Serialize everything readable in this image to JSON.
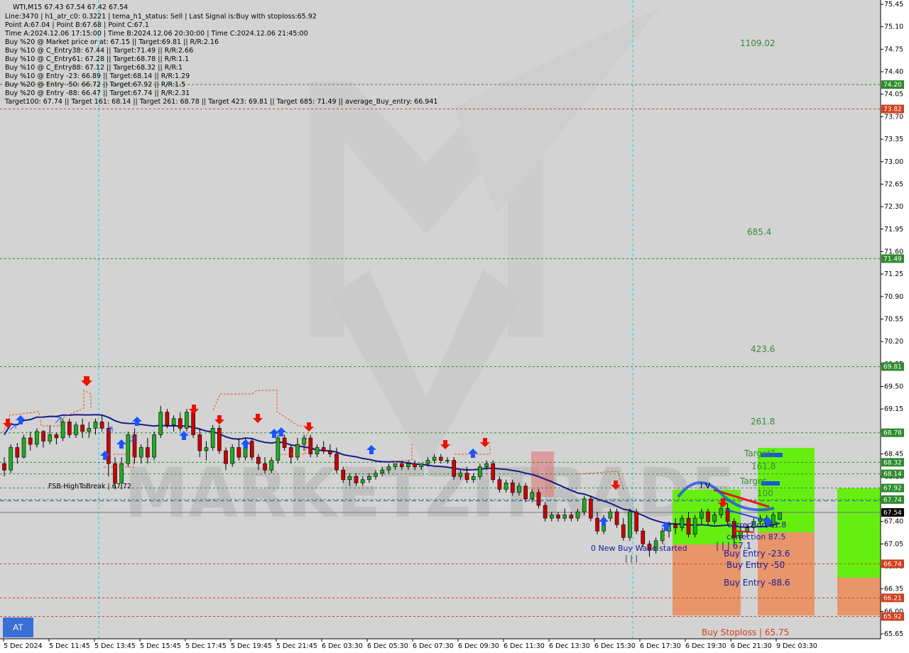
{
  "info_lines": [
    "WTI,M15  67.43 67.54 67.42 67.54",
    "Line:3470  |  h1_atr_c0: 0.3221  |  tema_h1_status: Sell  |  Last Signal is:Buy with stoploss:65.92",
    "Point A:67.04  |  Point B:67.68  |  Point C:67.1",
    "Time A:2024.12.06 17:15:00  |  Time B:2024.12.06 20:30:00  |  Time C:2024.12.06 21:45:00",
    "Buy %20 @ Market price or at: 67.15  ||  Target:69.81  ||  R/R:2.16",
    "Buy %10 @ C_Entry38: 67.44  ||  Target:71.49  ||  R/R:2.66",
    "Buy %10 @ C_Entry61: 67.28  ||  Target:68.78  ||  R/R:1.1",
    "Buy %10 @ C_Entry88: 67.12  ||  Target:68.32  ||  R/R:1",
    "Buy %10 @ Entry -23: 66.89  ||  Target:68.14  ||  R/R:1.29",
    "Buy %20 @ Entry -50: 66.72  ||  Target:67.92  ||  R/R:1.5",
    "Buy %20 @ Entry -88: 66.47  ||  Target:67.74  ||  R/R:2.31",
    "Target100: 67.74  ||  Target 161: 68.14  ||  Target 261: 68.78  ||  Target 423: 69.81  ||  Target 685: 71.49  ||  average_Buy_entry: 66.941"
  ],
  "colors": {
    "background": "#d3d3d3",
    "bull_candle": "#22aa22",
    "bear_candle": "#cc0000",
    "ma_line": "#1a1a8c",
    "target_line": "#2e8b2e",
    "stop_line": "#d04020",
    "green_zone": "#66ee11",
    "orange_zone": "#e8956a",
    "buy_arrow": "#1a55ff",
    "sell_arrow": "#ee1100"
  },
  "price_axis": {
    "min": 65.65,
    "max": 75.45,
    "ticks": [
      "75.45",
      "75.10",
      "74.75",
      "74.40",
      "74.05",
      "73.70",
      "73.35",
      "73.00",
      "72.65",
      "72.30",
      "71.95",
      "71.60",
      "71.25",
      "70.90",
      "70.55",
      "70.20",
      "69.85",
      "69.50",
      "69.15",
      "68.80",
      "68.45",
      "68.10",
      "67.75",
      "67.40",
      "67.05",
      "66.70",
      "66.35",
      "66.00",
      "65.65"
    ]
  },
  "level_tags": [
    {
      "label": "74.20",
      "price": 74.2,
      "color": "#2e8b2e"
    },
    {
      "label": "73.82",
      "price": 73.82,
      "color": "#d04020"
    },
    {
      "label": "71.49",
      "price": 71.49,
      "color": "#2e8b2e"
    },
    {
      "label": "69.81",
      "price": 69.81,
      "color": "#2e8b2e"
    },
    {
      "label": "68.78",
      "price": 68.78,
      "color": "#2e8b2e"
    },
    {
      "label": "68.32",
      "price": 68.32,
      "color": "#2e8b2e"
    },
    {
      "label": "68.14",
      "price": 68.14,
      "color": "#2e8b2e"
    },
    {
      "label": "67.92",
      "price": 67.92,
      "color": "#2e8b2e"
    },
    {
      "label": "67.74",
      "price": 67.74,
      "color": "#2e8b2e"
    },
    {
      "label": "67.54",
      "price": 67.54,
      "color": "#000000"
    },
    {
      "label": "66.74",
      "price": 66.74,
      "color": "#d04020"
    },
    {
      "label": "66.21",
      "price": 66.21,
      "color": "#d04020"
    },
    {
      "label": "65.92",
      "price": 65.92,
      "color": "#d04020"
    }
  ],
  "date_labels": [
    "5 Dec 2024",
    "5 Dec 11:45",
    "5 Dec 13:45",
    "5 Dec 15:45",
    "5 Dec 17:45",
    "5 Dec 19:45",
    "5 Dec 21:45",
    "6 Dec 03:30",
    "6 Dec 05:30",
    "6 Dec 07:30",
    "6 Dec 09:30",
    "6 Dec 11:30",
    "6 Dec 13:30",
    "6 Dec 15:30",
    "6 Dec 17:30",
    "6 Dec 19:30",
    "6 Dec 21:30",
    "9 Dec 03:30"
  ],
  "chart_labels": {
    "t1109": "1109.02",
    "t685": "685.4",
    "t423": "423.6",
    "t261": "261.8",
    "t161": "161.8",
    "t100": "100",
    "target_a": "Target1",
    "target_b": "Target",
    "corr1": "correction 61.8",
    "corr2": "correction 87.5",
    "point_c": "| | | 67.1",
    "roman": "I V",
    "buy_wave": "0 New Buy Wave started",
    "entry23": "Buy Entry -23.6",
    "entry50": "Buy Entry -50",
    "entry88": "Buy Entry -88.6",
    "stoploss": "Buy Stoploss | 65.75",
    "fsb": "FSB-HighToBreak | 67.72",
    "watermark": "MARKETZITRADE"
  },
  "at_button": "AT",
  "chart_data": {
    "type": "candlestick",
    "title": "WTI,M15",
    "timeframe": "M15",
    "ylim": [
      65.65,
      75.45
    ],
    "last_price": 67.54,
    "candles": [
      [
        68.3,
        68.4,
        68.1,
        68.2
      ],
      [
        68.2,
        68.6,
        68.15,
        68.55
      ],
      [
        68.55,
        68.62,
        68.3,
        68.4
      ],
      [
        68.4,
        68.75,
        68.38,
        68.7
      ],
      [
        68.7,
        68.8,
        68.5,
        68.6
      ],
      [
        68.6,
        68.85,
        68.55,
        68.8
      ],
      [
        68.8,
        68.82,
        68.55,
        68.65
      ],
      [
        68.65,
        68.9,
        68.6,
        68.75
      ],
      [
        68.75,
        68.78,
        68.6,
        68.7
      ],
      [
        68.7,
        69.0,
        68.65,
        68.95
      ],
      [
        68.95,
        69.0,
        68.7,
        68.75
      ],
      [
        68.75,
        68.95,
        68.7,
        68.9
      ],
      [
        68.9,
        69.0,
        68.7,
        68.8
      ],
      [
        68.8,
        68.95,
        68.7,
        68.85
      ],
      [
        68.85,
        69.0,
        68.75,
        68.95
      ],
      [
        68.95,
        69.05,
        68.8,
        68.85
      ],
      [
        68.85,
        68.95,
        68.1,
        68.3
      ],
      [
        68.3,
        68.4,
        67.9,
        68.0
      ],
      [
        68.0,
        68.4,
        67.9,
        68.3
      ],
      [
        68.3,
        68.8,
        68.25,
        68.75
      ],
      [
        68.75,
        68.85,
        68.3,
        68.4
      ],
      [
        68.4,
        68.6,
        68.3,
        68.55
      ],
      [
        68.55,
        68.7,
        68.3,
        68.4
      ],
      [
        68.4,
        68.8,
        68.35,
        68.75
      ],
      [
        68.75,
        69.2,
        68.7,
        69.1
      ],
      [
        69.1,
        69.15,
        68.85,
        68.9
      ],
      [
        68.9,
        69.05,
        68.8,
        69.0
      ],
      [
        69.0,
        69.1,
        68.8,
        68.85
      ],
      [
        68.85,
        69.15,
        68.8,
        69.1
      ],
      [
        69.1,
        69.15,
        68.7,
        68.75
      ],
      [
        68.75,
        68.85,
        68.4,
        68.5
      ],
      [
        68.5,
        68.65,
        68.35,
        68.55
      ],
      [
        68.55,
        68.9,
        68.5,
        68.85
      ],
      [
        68.85,
        68.9,
        68.45,
        68.5
      ],
      [
        68.5,
        68.55,
        68.2,
        68.3
      ],
      [
        68.3,
        68.6,
        68.25,
        68.55
      ],
      [
        68.55,
        68.7,
        68.35,
        68.4
      ],
      [
        68.4,
        68.7,
        68.35,
        68.65
      ],
      [
        68.65,
        68.7,
        68.35,
        68.4
      ],
      [
        68.4,
        68.45,
        68.2,
        68.3
      ],
      [
        68.3,
        68.4,
        68.15,
        68.2
      ],
      [
        68.2,
        68.4,
        68.15,
        68.35
      ],
      [
        68.35,
        68.75,
        68.3,
        68.7
      ],
      [
        68.7,
        68.75,
        68.5,
        68.55
      ],
      [
        68.55,
        68.6,
        68.3,
        68.4
      ],
      [
        68.4,
        68.7,
        68.35,
        68.6
      ],
      [
        68.6,
        68.75,
        68.5,
        68.7
      ],
      [
        68.7,
        68.75,
        68.4,
        68.45
      ],
      [
        68.45,
        68.6,
        68.4,
        68.55
      ],
      [
        68.55,
        68.65,
        68.45,
        68.5
      ],
      [
        68.5,
        68.6,
        68.4,
        68.45
      ],
      [
        68.45,
        68.55,
        68.15,
        68.2
      ],
      [
        68.2,
        68.25,
        68.0,
        68.05
      ],
      [
        68.05,
        68.15,
        67.95,
        68.1
      ],
      [
        68.1,
        68.15,
        67.95,
        68.0
      ],
      [
        68.0,
        68.1,
        67.95,
        68.05
      ],
      [
        68.05,
        68.15,
        68.0,
        68.1
      ],
      [
        68.1,
        68.2,
        68.05,
        68.15
      ],
      [
        68.15,
        68.25,
        68.1,
        68.2
      ],
      [
        68.2,
        68.3,
        68.15,
        68.25
      ],
      [
        68.25,
        68.3,
        68.2,
        68.3
      ],
      [
        68.3,
        68.35,
        68.2,
        68.25
      ],
      [
        68.25,
        68.35,
        68.2,
        68.3
      ],
      [
        68.3,
        68.35,
        68.2,
        68.25
      ],
      [
        68.25,
        68.3,
        68.2,
        68.3
      ],
      [
        68.3,
        68.4,
        68.25,
        68.35
      ],
      [
        68.35,
        68.45,
        68.3,
        68.4
      ],
      [
        68.4,
        68.45,
        68.3,
        68.35
      ],
      [
        68.35,
        68.4,
        68.3,
        68.35
      ],
      [
        68.35,
        68.4,
        68.05,
        68.1
      ],
      [
        68.1,
        68.2,
        68.05,
        68.15
      ],
      [
        68.15,
        68.25,
        68.0,
        68.05
      ],
      [
        68.05,
        68.15,
        68.0,
        68.1
      ],
      [
        68.1,
        68.3,
        68.05,
        68.25
      ],
      [
        68.25,
        68.35,
        68.2,
        68.3
      ],
      [
        68.3,
        68.35,
        68.0,
        68.05
      ],
      [
        68.05,
        68.1,
        67.85,
        67.9
      ],
      [
        67.9,
        68.05,
        67.85,
        68.0
      ],
      [
        68.0,
        68.05,
        67.8,
        67.85
      ],
      [
        67.85,
        68.0,
        67.8,
        67.95
      ],
      [
        67.95,
        68.0,
        67.7,
        67.75
      ],
      [
        67.75,
        67.9,
        67.7,
        67.85
      ],
      [
        67.85,
        67.9,
        67.6,
        67.65
      ],
      [
        67.65,
        67.7,
        67.4,
        67.45
      ],
      [
        67.45,
        67.55,
        67.4,
        67.5
      ],
      [
        67.5,
        67.55,
        67.4,
        67.45
      ],
      [
        67.45,
        67.6,
        67.4,
        67.5
      ],
      [
        67.5,
        67.55,
        67.4,
        67.45
      ],
      [
        67.45,
        67.6,
        67.4,
        67.55
      ],
      [
        67.55,
        67.8,
        67.5,
        67.75
      ],
      [
        67.75,
        67.8,
        67.4,
        67.45
      ],
      [
        67.45,
        67.55,
        67.2,
        67.25
      ],
      [
        67.25,
        67.5,
        67.2,
        67.45
      ],
      [
        67.45,
        67.6,
        67.4,
        67.55
      ],
      [
        67.55,
        67.6,
        67.3,
        67.35
      ],
      [
        67.35,
        67.45,
        67.1,
        67.15
      ],
      [
        67.15,
        67.6,
        67.1,
        67.55
      ],
      [
        67.55,
        67.6,
        67.2,
        67.25
      ],
      [
        67.25,
        67.3,
        67.0,
        67.05
      ],
      [
        67.05,
        67.1,
        66.85,
        66.95
      ],
      [
        66.95,
        67.15,
        66.9,
        67.1
      ],
      [
        67.1,
        67.3,
        67.05,
        67.25
      ],
      [
        67.25,
        67.4,
        67.15,
        67.35
      ],
      [
        67.35,
        67.45,
        67.2,
        67.3
      ],
      [
        67.3,
        67.5,
        67.25,
        67.45
      ],
      [
        67.45,
        67.55,
        67.15,
        67.2
      ],
      [
        67.2,
        67.5,
        67.15,
        67.45
      ],
      [
        67.45,
        67.6,
        67.35,
        67.55
      ],
      [
        67.55,
        67.6,
        67.35,
        67.4
      ],
      [
        67.4,
        67.55,
        67.35,
        67.5
      ],
      [
        67.5,
        67.68,
        67.45,
        67.6
      ],
      [
        67.6,
        67.68,
        67.35,
        67.4
      ],
      [
        67.4,
        67.45,
        67.05,
        67.15
      ],
      [
        67.15,
        67.35,
        67.1,
        67.25
      ],
      [
        67.25,
        67.35,
        67.15,
        67.3
      ],
      [
        67.3,
        67.45,
        67.25,
        67.4
      ],
      [
        67.4,
        67.5,
        67.35,
        67.45
      ],
      [
        67.45,
        67.5,
        67.3,
        67.35
      ],
      [
        67.35,
        67.55,
        67.3,
        67.5
      ],
      [
        67.43,
        67.54,
        67.42,
        67.54
      ]
    ],
    "levels": [
      {
        "name": "1109.02",
        "price": 74.2
      },
      {
        "name": "685.4",
        "price": 71.49
      },
      {
        "name": "423.6",
        "price": 69.81
      },
      {
        "name": "261.8",
        "price": 68.78
      },
      {
        "name": "161.8",
        "price": 68.14
      },
      {
        "name": "100",
        "price": 67.74
      }
    ]
  }
}
